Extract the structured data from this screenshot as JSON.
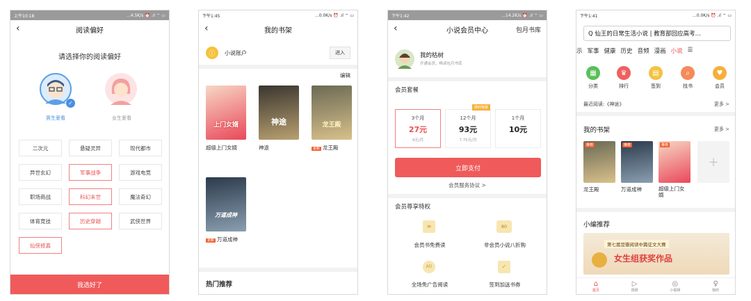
{
  "p1": {
    "status_time": "上午10:18",
    "status_right": "...4.5K/s ⏰ .ıl ⌔ ▭",
    "title": "阅读偏好",
    "prompt": "请选择你的阅读偏好",
    "male_label": "男生爱看",
    "female_label": "女生爱看",
    "chips": [
      {
        "label": "二次元",
        "selected": false
      },
      {
        "label": "悬疑灵异",
        "selected": false
      },
      {
        "label": "现代都市",
        "selected": false
      },
      {
        "label": "异世玄幻",
        "selected": false
      },
      {
        "label": "军事战争",
        "selected": true
      },
      {
        "label": "游戏电竞",
        "selected": false
      },
      {
        "label": "职场商战",
        "selected": false
      },
      {
        "label": "科幻末世",
        "selected": true
      },
      {
        "label": "魔法奇幻",
        "selected": false
      },
      {
        "label": "体育竞技",
        "selected": false
      },
      {
        "label": "历史穿越",
        "selected": true
      },
      {
        "label": "武侠世界",
        "selected": false
      },
      {
        "label": "仙侠修真",
        "selected": true
      }
    ],
    "confirm": "我选好了"
  },
  "p2": {
    "status_time": "下午1:45",
    "status_right": "...0.0K/s ⏰ .ıl ⌔ ▭",
    "title": "我的书架",
    "account": "小说账户",
    "account_icon": "ⓘ",
    "enter": "进入",
    "edit": "编辑",
    "books": [
      {
        "title": "超级上门女婿",
        "cover_text": "上门女婿",
        "tag": ""
      },
      {
        "title": "神途",
        "cover_text": "神途",
        "tag": ""
      },
      {
        "title": "龙王殿",
        "cover_text": "龙王殿",
        "tag": "更新"
      },
      {
        "title": "万道成神",
        "cover_text": "万道成神",
        "tag": "更新"
      }
    ],
    "hot": "热门推荐"
  },
  "p3": {
    "status_time": "下午1:42",
    "status_right": "...14.2K/s ⏰ .ıl ⌔ ▭",
    "title": "小说会员中心",
    "right": "包月书库",
    "user_name": "我的枯树",
    "user_sub": "开通会员，畅读包月书库",
    "pkg_title": "会员套餐",
    "packages": [
      {
        "label": "3个月",
        "price": "27元",
        "per": "9元/月",
        "badge": ""
      },
      {
        "label": "12个月",
        "price": "93元",
        "per": "7.75元/月",
        "badge": "限时特惠"
      },
      {
        "label": "1个月",
        "price": "10元",
        "per": "",
        "badge": ""
      }
    ],
    "pay": "立即支付",
    "agreement": "会员服务协议 >",
    "priv_title": "会员尊享特权",
    "privileges": [
      "会员书免费读",
      "非会员小说八折购",
      "全场免广告阅读",
      "签到加送书券"
    ],
    "priv_badges": [
      "≡",
      "80",
      "AD",
      "✓"
    ]
  },
  "p4": {
    "status_time": "下午1:41",
    "status_right": "...0.0K/s ⏰ .ıl ⌔ ▭",
    "search": "Q 仙王的日常生活小说 | 教育部回应高考...",
    "tabs": [
      "示",
      "军事",
      "健康",
      "历史",
      "音频",
      "漫画",
      "小说",
      "☰"
    ],
    "active_tab": "小说",
    "icons": [
      {
        "label": "分类",
        "color": "#5bbf5a",
        "glyph": "▦"
      },
      {
        "label": "排行",
        "color": "#f06060",
        "glyph": "♛"
      },
      {
        "label": "签到",
        "color": "#f5c242",
        "glyph": "▤"
      },
      {
        "label": "找书",
        "color": "#f58a5a",
        "glyph": "⌕"
      },
      {
        "label": "会员",
        "color": "#f5b03a",
        "glyph": "♥"
      }
    ],
    "recent": "最近阅读:《神途》",
    "more": "更多 >",
    "shelf_title": "我的书架",
    "shelf_books": [
      {
        "title": "龙王殿",
        "badge": "推荐"
      },
      {
        "title": "万道成神",
        "badge": "推荐"
      },
      {
        "title": "超级上门女婿",
        "badge": "推荐"
      }
    ],
    "add": "+",
    "editor_title": "小编推荐",
    "banner_line1": "第七届豆瓣阅读中篇征文大赛",
    "banner_line2": "女生组获奖作品",
    "nav": [
      "首页",
      "视频",
      "小视频",
      "我的"
    ],
    "nav_glyphs": [
      "⌂",
      "▷",
      "◎",
      "♀"
    ]
  }
}
